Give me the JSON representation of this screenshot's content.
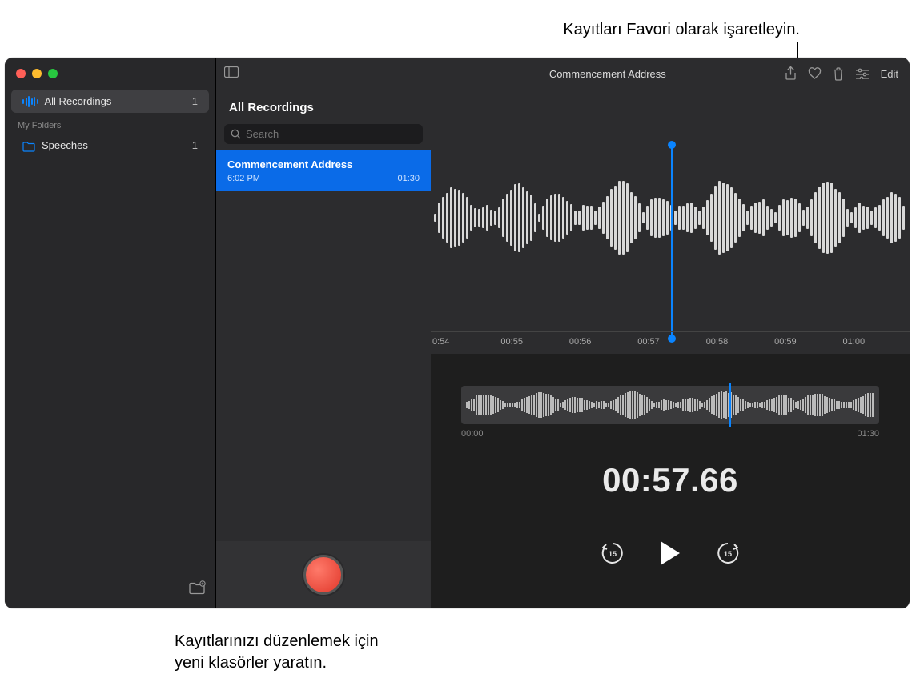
{
  "callouts": {
    "top": "Kayıtları Favori olarak işaretleyin.",
    "bottom_line1": "Kayıtlarınızı düzenlemek için",
    "bottom_line2": "yeni klasörler yaratın."
  },
  "sidebar": {
    "all_recordings_label": "All Recordings",
    "all_recordings_count": "1",
    "my_folders_label": "My Folders",
    "folders": [
      {
        "name": "Speeches",
        "count": "1"
      }
    ]
  },
  "middle": {
    "header": "All Recordings",
    "search_placeholder": "Search",
    "recordings": [
      {
        "title": "Commencement Address",
        "time": "6:02 PM",
        "duration": "01:30"
      }
    ]
  },
  "detail": {
    "title": "Commencement Address",
    "edit_label": "Edit",
    "axis": [
      "0:54",
      "00:55",
      "00:56",
      "00:57",
      "00:58",
      "00:59",
      "01:00"
    ],
    "overview_start": "00:00",
    "overview_end": "01:30",
    "current_time": "00:57.66",
    "skip_amount": "15"
  },
  "colors": {
    "accent": "#0a84ff",
    "record": "#e0372a"
  }
}
